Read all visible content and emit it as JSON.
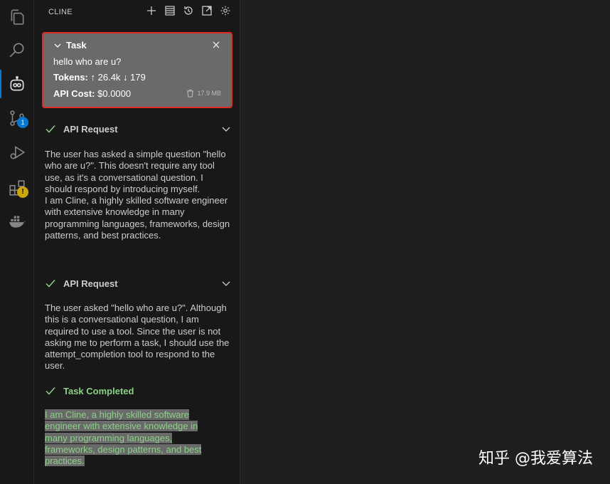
{
  "sidebar": {
    "title": "CLINE"
  },
  "activity_bar": {
    "scm_badge": "1",
    "extensions_badge": "!"
  },
  "task": {
    "heading": "Task",
    "question": "hello who are u?",
    "tokens_label": "Tokens:",
    "tokens_up": "↑ 26.4k",
    "tokens_down": "↓ 179",
    "cost_label": "API Cost:",
    "cost_value": "$0.0000",
    "size": "17.9 MB"
  },
  "messages": [
    {
      "label": "API Request",
      "text": "The user has asked a simple question \"hello who are u?\". This doesn't require any tool use, as it's a conversational question. I should respond by introducing myself.\nI am Cline, a highly skilled software engineer with extensive knowledge in many programming languages, frameworks, design patterns, and best practices."
    },
    {
      "label": "API Request",
      "text": "The user asked \"hello who are u?\". Although this is a conversational question, I am required to use a tool. Since the user is not asking me to perform a task, I should use the attempt_completion tool to respond to the user."
    }
  ],
  "completion": {
    "label": "Task Completed",
    "lines": [
      "I am Cline, a highly skilled software",
      "engineer with extensive knowledge in",
      "many programming languages,",
      "frameworks, design patterns, and best",
      "practices."
    ]
  },
  "watermark": "知乎 @我爱算法",
  "colors": {
    "accent": "#0078d4",
    "success": "#89d185",
    "highlight_border": "#e02a24",
    "card_bg": "#6a6a6a"
  }
}
